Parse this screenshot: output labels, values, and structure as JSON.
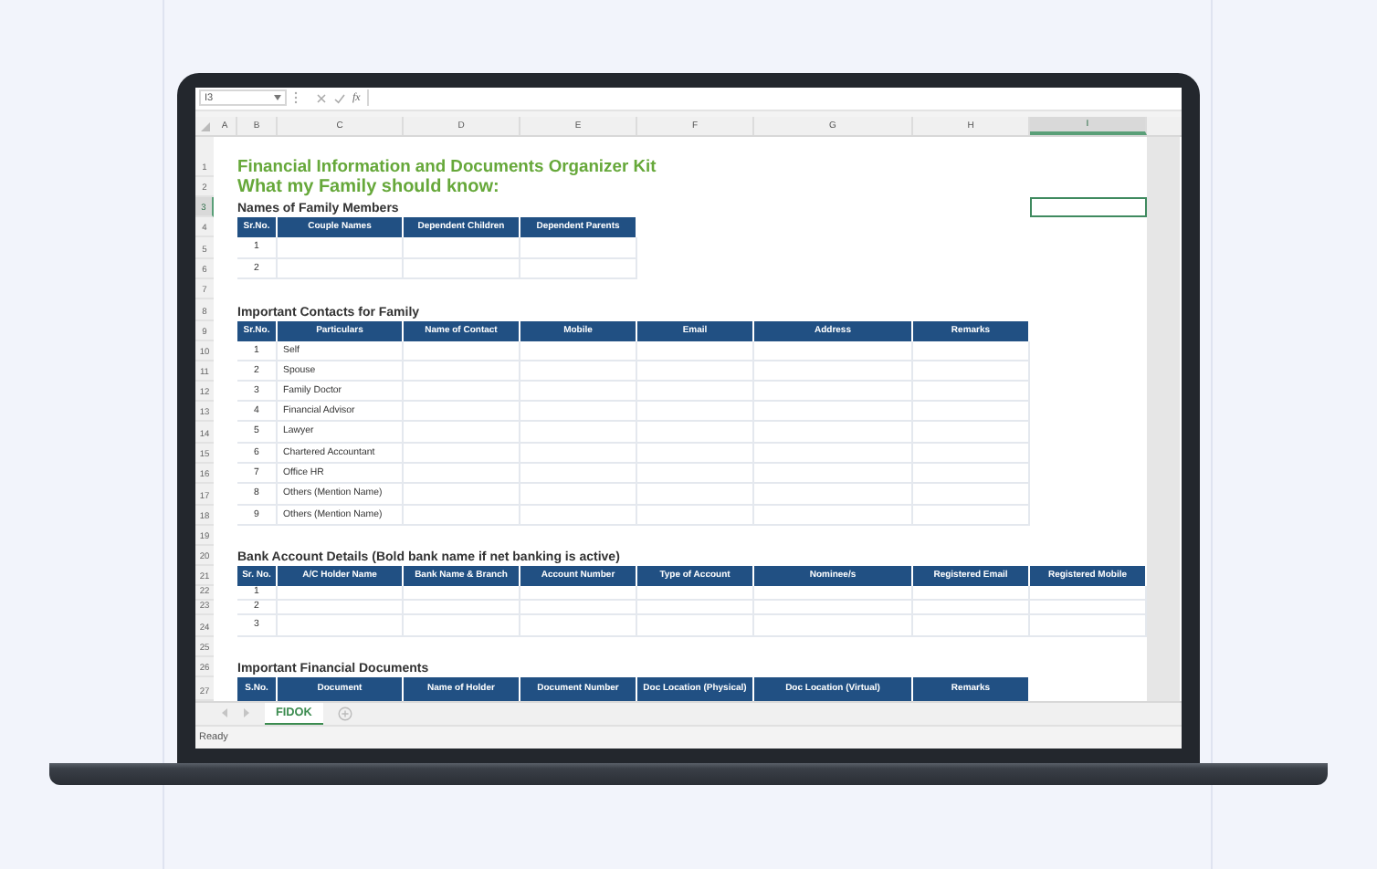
{
  "formula_bar": {
    "name_box": "I3",
    "function_label": "fx"
  },
  "column_headers": [
    {
      "label": "A",
      "selected": false
    },
    {
      "label": "B",
      "selected": false
    },
    {
      "label": "C",
      "selected": false
    },
    {
      "label": "D",
      "selected": false
    },
    {
      "label": "E",
      "selected": false
    },
    {
      "label": "F",
      "selected": false
    },
    {
      "label": "G",
      "selected": false
    },
    {
      "label": "H",
      "selected": false
    },
    {
      "label": "I",
      "selected": true
    }
  ],
  "row_numbers": [
    {
      "label": "1",
      "selected": false
    },
    {
      "label": "2",
      "selected": false
    },
    {
      "label": "3",
      "selected": true
    },
    {
      "label": "4",
      "selected": false
    },
    {
      "label": "5",
      "selected": false
    },
    {
      "label": "6",
      "selected": false
    },
    {
      "label": "7",
      "selected": false
    },
    {
      "label": "8",
      "selected": false
    },
    {
      "label": "9",
      "selected": false
    },
    {
      "label": "10",
      "selected": false
    },
    {
      "label": "11",
      "selected": false
    },
    {
      "label": "12",
      "selected": false
    },
    {
      "label": "13",
      "selected": false
    },
    {
      "label": "14",
      "selected": false
    },
    {
      "label": "15",
      "selected": false
    },
    {
      "label": "16",
      "selected": false
    },
    {
      "label": "17",
      "selected": false
    },
    {
      "label": "18",
      "selected": false
    },
    {
      "label": "19",
      "selected": false
    },
    {
      "label": "20",
      "selected": false
    },
    {
      "label": "21",
      "selected": false
    },
    {
      "label": "22",
      "selected": false
    },
    {
      "label": "23",
      "selected": false
    },
    {
      "label": "24",
      "selected": false
    },
    {
      "label": "25",
      "selected": false
    },
    {
      "label": "26",
      "selected": false
    },
    {
      "label": "27",
      "selected": false
    }
  ],
  "title": "Financial Information and Documents Organizer Kit",
  "subtitle": "What my Family should know:",
  "sections": [
    {
      "heading": "Names of Family Members",
      "columns": [
        "Sr.No.",
        "Couple Names",
        "Dependent Children",
        "Dependent Parents"
      ],
      "rows": [
        [
          "1"
        ],
        [
          "2"
        ]
      ]
    },
    {
      "heading": "Important Contacts for Family",
      "columns": [
        "Sr.No.",
        "Particulars",
        "Name of Contact",
        "Mobile",
        "Email",
        "Address",
        "Remarks"
      ],
      "rows": [
        [
          "1",
          "Self"
        ],
        [
          "2",
          "Spouse"
        ],
        [
          "3",
          "Family Doctor"
        ],
        [
          "4",
          "Financial Advisor"
        ],
        [
          "5",
          "Lawyer"
        ],
        [
          "6",
          "Chartered Accountant"
        ],
        [
          "7",
          "Office HR"
        ],
        [
          "8",
          "Others (Mention Name)"
        ],
        [
          "9",
          "Others (Mention Name)"
        ]
      ]
    },
    {
      "heading": "Bank Account Details (Bold bank name if net banking is active)",
      "columns": [
        "Sr. No.",
        "A/C Holder Name",
        "Bank Name & Branch",
        "Account Number",
        "Type of Account",
        "Nominee/s",
        "Registered Email",
        "Registered Mobile"
      ],
      "rows": [
        [
          "1"
        ],
        [
          "2"
        ],
        [
          "3"
        ]
      ]
    },
    {
      "heading": "Important Financial Documents",
      "columns": [
        "S.No.",
        "Document",
        "Name of Holder",
        "Document Number",
        "Doc Location (Physical)",
        "Doc Location (Virtual)",
        "Remarks"
      ]
    }
  ],
  "sheet_tabs": [
    {
      "label": "FIDOK",
      "selected": true
    }
  ],
  "status_bar": {
    "text": "Ready"
  }
}
